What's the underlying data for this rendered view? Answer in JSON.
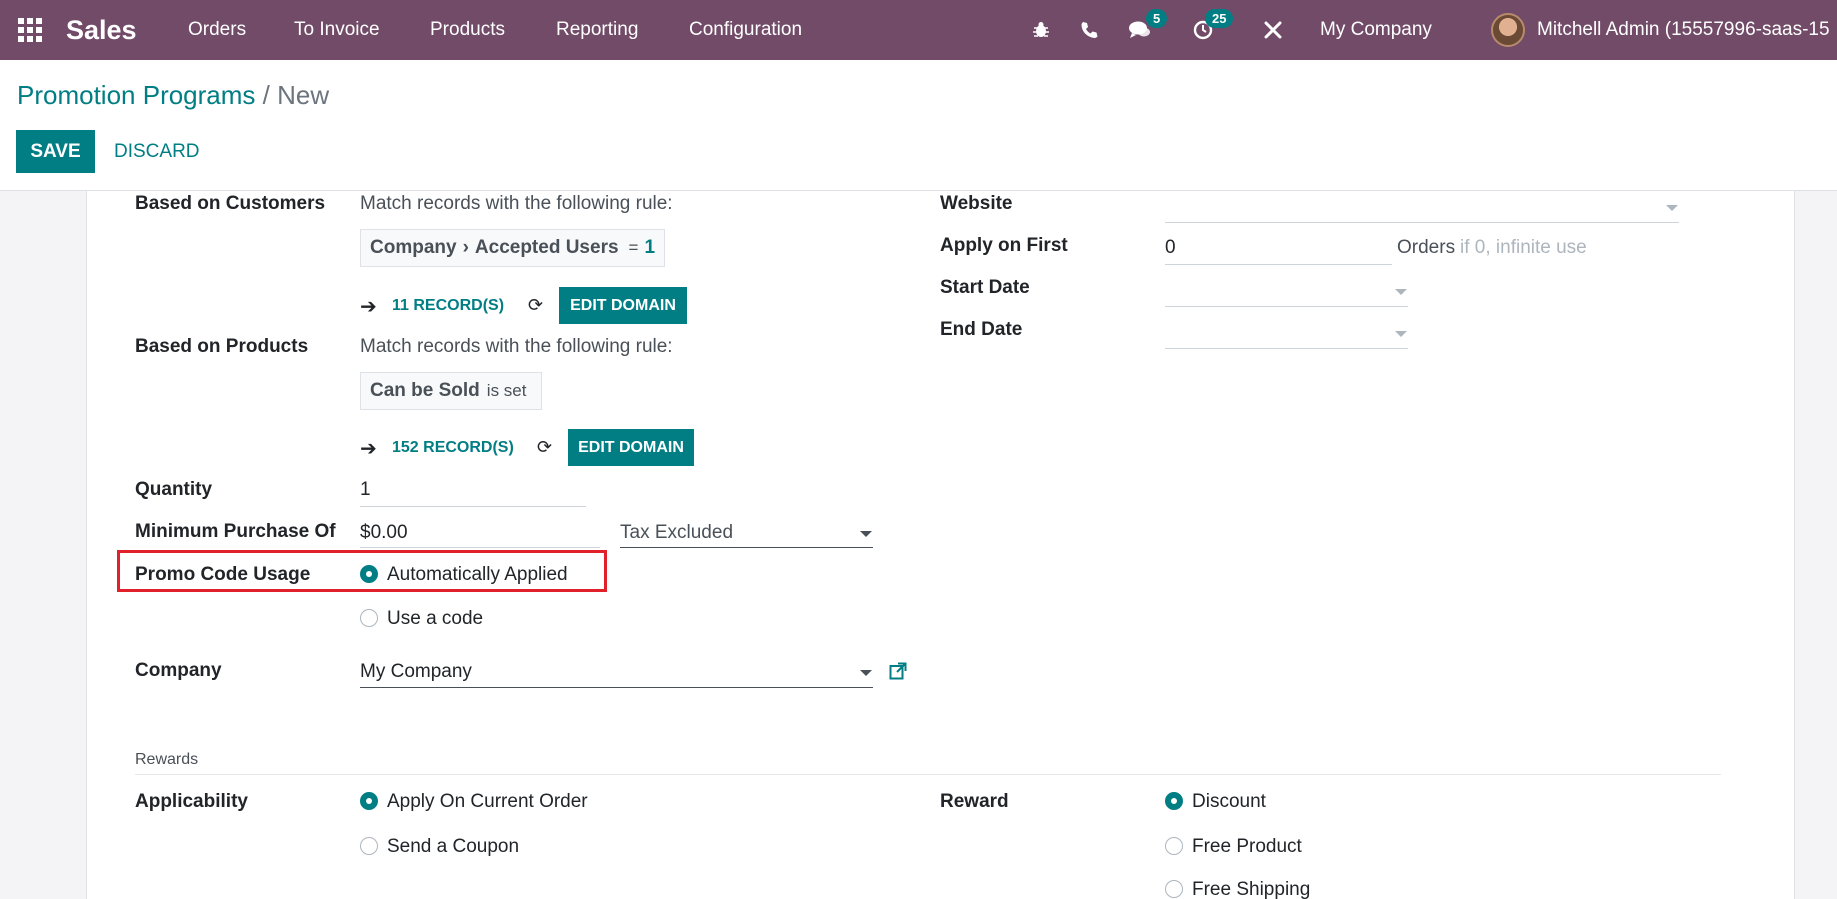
{
  "navbar": {
    "app_name": "Sales",
    "menu": [
      "Orders",
      "To Invoice",
      "Products",
      "Reporting",
      "Configuration"
    ],
    "messages_count": "5",
    "activities_count": "25",
    "company": "My Company",
    "user": "Mitchell Admin (15557996-saas-15",
    "icons": [
      "apps-icon",
      "bug-icon",
      "phone-icon",
      "chat-icon",
      "activity-clock-icon",
      "tools-icon"
    ],
    "color": "#714b67"
  },
  "control": {
    "breadcrumb_parent": "Promotion Programs",
    "breadcrumb_sep": "/",
    "breadcrumb_current": "New",
    "save_label": "SAVE",
    "discard_label": "DISCARD"
  },
  "form": {
    "customers": {
      "label": "Based on Customers",
      "rule_text": "Match records with the following rule:",
      "chip_part1": "Company",
      "chip_part2": "Accepted Users",
      "chip_op": "=",
      "chip_value": "1",
      "records": "11 RECORD(S)",
      "edit_label": "EDIT DOMAIN"
    },
    "products": {
      "label": "Based on Products",
      "rule_text": "Match records with the following rule:",
      "chip_part1": "Can be Sold",
      "chip_suffix": "is set",
      "records": "152 RECORD(S)",
      "edit_label": "EDIT DOMAIN"
    },
    "quantity": {
      "label": "Quantity",
      "value": "1"
    },
    "min_purchase": {
      "label": "Minimum Purchase Of",
      "value": "$0.00",
      "tax": "Tax Excluded"
    },
    "promo_usage": {
      "label": "Promo Code Usage",
      "option_auto": "Automatically Applied",
      "option_code": "Use a code",
      "selected": "Automatically Applied"
    },
    "company": {
      "label": "Company",
      "value": "My Company"
    },
    "website": {
      "label": "Website",
      "value": ""
    },
    "apply_first": {
      "label": "Apply on First",
      "value": "0",
      "suffix": "Orders",
      "hint": "if 0, infinite use"
    },
    "start_date": {
      "label": "Start Date",
      "value": ""
    },
    "end_date": {
      "label": "End Date",
      "value": ""
    },
    "rewards": {
      "section_title": "Rewards",
      "applicability_label": "Applicability",
      "applicability_options": [
        "Apply On Current Order",
        "Send a Coupon"
      ],
      "applicability_selected": "Apply On Current Order",
      "reward_label": "Reward",
      "reward_options": [
        "Discount",
        "Free Product",
        "Free Shipping"
      ],
      "reward_selected": "Discount"
    }
  },
  "colors": {
    "primary": "#017e84",
    "highlight": "#e0202a"
  }
}
